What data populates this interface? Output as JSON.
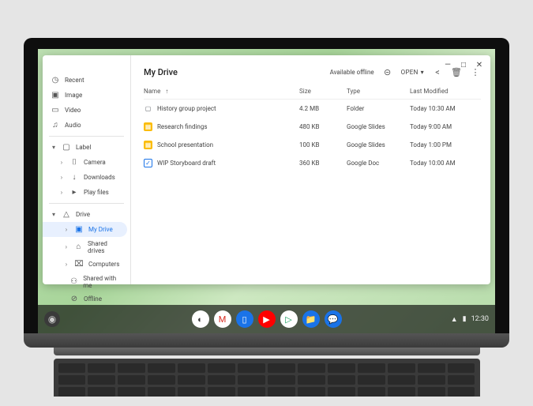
{
  "window_controls": {
    "min": "—",
    "max": "□",
    "close": "✕"
  },
  "sidebar": {
    "recent": "Recent",
    "image": "Image",
    "video": "Video",
    "audio": "Audio",
    "label_hdr": "Label",
    "camera": "Camera",
    "downloads": "Downloads",
    "playfiles": "Play files",
    "drive": "Drive",
    "mydrive": "My Drive",
    "shareddrives": "Shared drives",
    "computers": "Computers",
    "sharedwithme": "Shared with me",
    "offline": "Offline"
  },
  "main": {
    "title": "My Drive",
    "available_offline": "Available offline",
    "open": "OPEN",
    "cols": {
      "name": "Name",
      "size": "Size",
      "type": "Type",
      "modified": "Last Modified"
    }
  },
  "files": [
    {
      "name": "History group project",
      "size": "4.2 MB",
      "type": "Folder",
      "modified": "Today 10:30 AM",
      "kind": "folder"
    },
    {
      "name": "Research findings",
      "size": "480 KB",
      "type": "Google Slides",
      "modified": "Today 9:00 AM",
      "kind": "slides"
    },
    {
      "name": "School presentation",
      "size": "100 KB",
      "type": "Google Slides",
      "modified": "Today 1:00 PM",
      "kind": "slides"
    },
    {
      "name": "WIP Storyboard draft",
      "size": "360 KB",
      "type": "Google Doc",
      "modified": "Today 10:00 AM",
      "kind": "doc"
    }
  ],
  "shelf": {
    "time": "12:30"
  }
}
